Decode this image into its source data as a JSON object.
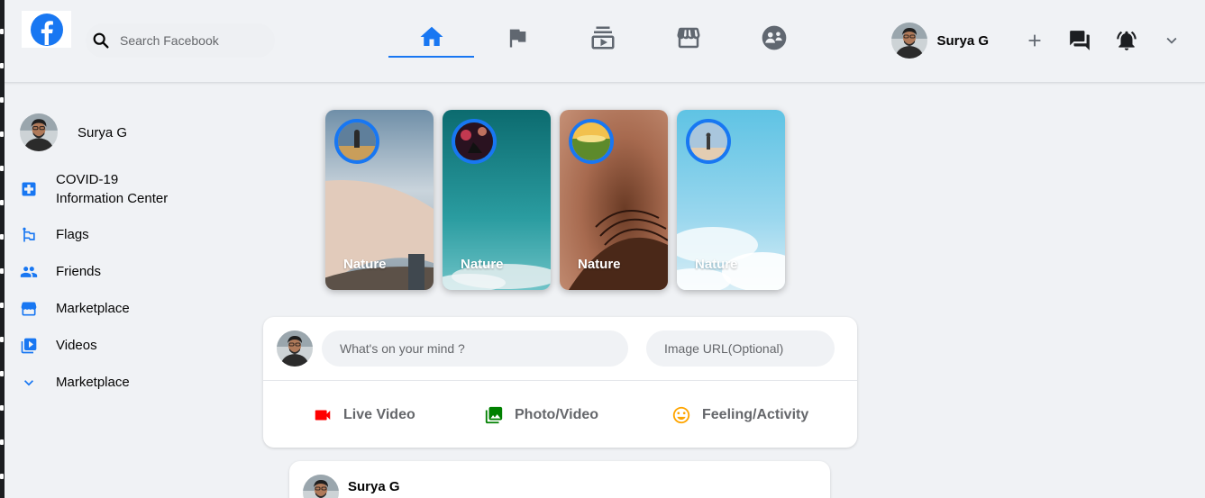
{
  "app": {
    "name": "Facebook"
  },
  "search": {
    "placeholder": "Search Facebook"
  },
  "nav": [
    {
      "name": "Home",
      "icon": "home-icon",
      "active": true
    },
    {
      "name": "Pages",
      "icon": "flag-icon",
      "active": false
    },
    {
      "name": "Watch",
      "icon": "subscriptions-icon",
      "active": false
    },
    {
      "name": "Marketplace",
      "icon": "storefront-icon",
      "active": false
    },
    {
      "name": "Groups",
      "icon": "supervised-user-icon",
      "active": false
    }
  ],
  "user": {
    "name": "Surya G"
  },
  "header_actions": [
    {
      "icon": "add-icon"
    },
    {
      "icon": "forum-icon"
    },
    {
      "icon": "notifications-active-icon"
    },
    {
      "icon": "expand-more-icon"
    }
  ],
  "sidebar": {
    "user_name": "Surya G",
    "items": [
      {
        "label_line1": "COVID-19",
        "label_line2": "Information Center",
        "icon": "local-hospital-icon"
      },
      {
        "label": "Flags",
        "icon": "emoji-flags-icon"
      },
      {
        "label": "Friends",
        "icon": "people-icon"
      },
      {
        "label": "Marketplace",
        "icon": "storefront-icon"
      },
      {
        "label": "Videos",
        "icon": "video-library-icon"
      },
      {
        "label": "Marketplace",
        "icon": "expand-more-icon"
      }
    ]
  },
  "stories": [
    {
      "title": "Nature"
    },
    {
      "title": "Nature"
    },
    {
      "title": "Nature"
    },
    {
      "title": "Nature"
    }
  ],
  "composer": {
    "message_placeholder": "What's on your mind ?",
    "image_placeholder": "Image URL(Optional)",
    "actions": [
      {
        "label": "Live Video",
        "icon": "videocam-icon",
        "color": "#ff0000"
      },
      {
        "label": "Photo/Video",
        "icon": "photo-library-icon",
        "color": "#008000"
      },
      {
        "label": "Feeling/Activity",
        "icon": "insert-emoticon-icon",
        "color": "#ffa500"
      }
    ]
  },
  "post": {
    "user_name": "Surya G"
  },
  "colors": {
    "accent": "#1877f2",
    "background": "#f0f2f5"
  }
}
